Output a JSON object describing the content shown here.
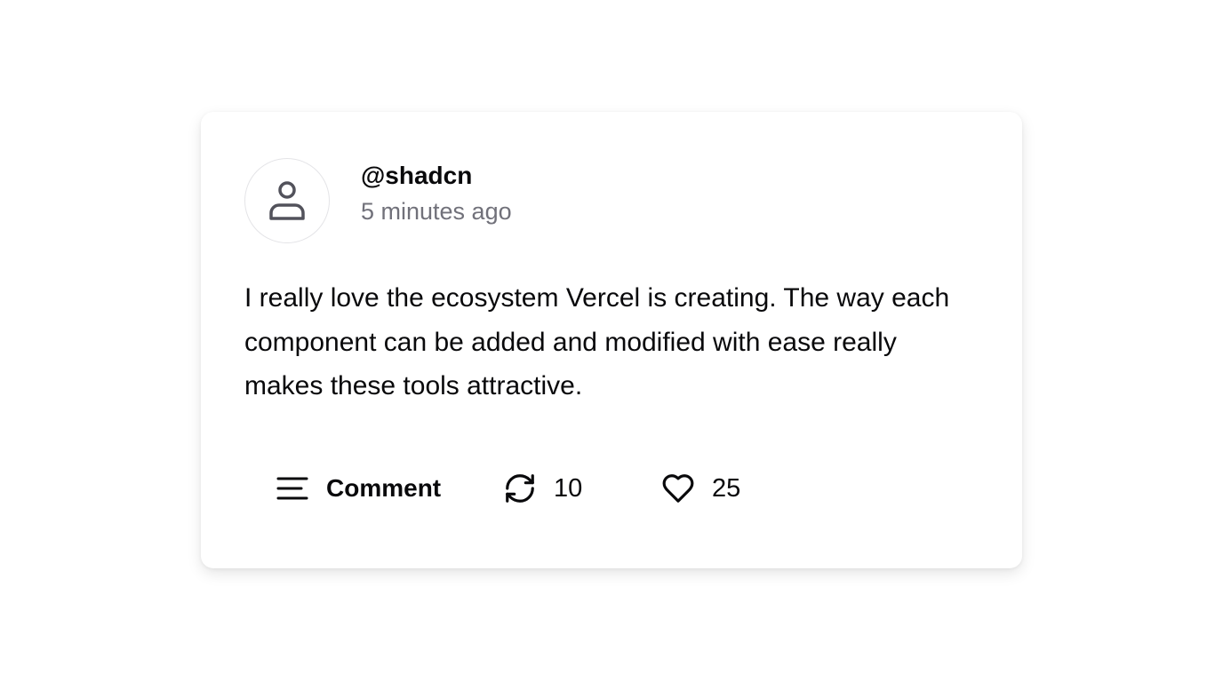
{
  "post": {
    "username": "@shadcn",
    "timestamp": "5 minutes ago",
    "body": "I really love the ecosystem Vercel is creating. The way each component can be added and modified with ease really makes these tools attractive.",
    "avatar_icon": "user-icon"
  },
  "actions": {
    "comment_label": "Comment",
    "comment_icon": "align-left-icon",
    "repost_count": "10",
    "repost_icon": "refresh-icon",
    "like_count": "25",
    "like_icon": "heart-icon"
  },
  "colors": {
    "text": "#09090b",
    "muted": "#71717a",
    "border": "#e4e4e7",
    "background": "#ffffff"
  }
}
